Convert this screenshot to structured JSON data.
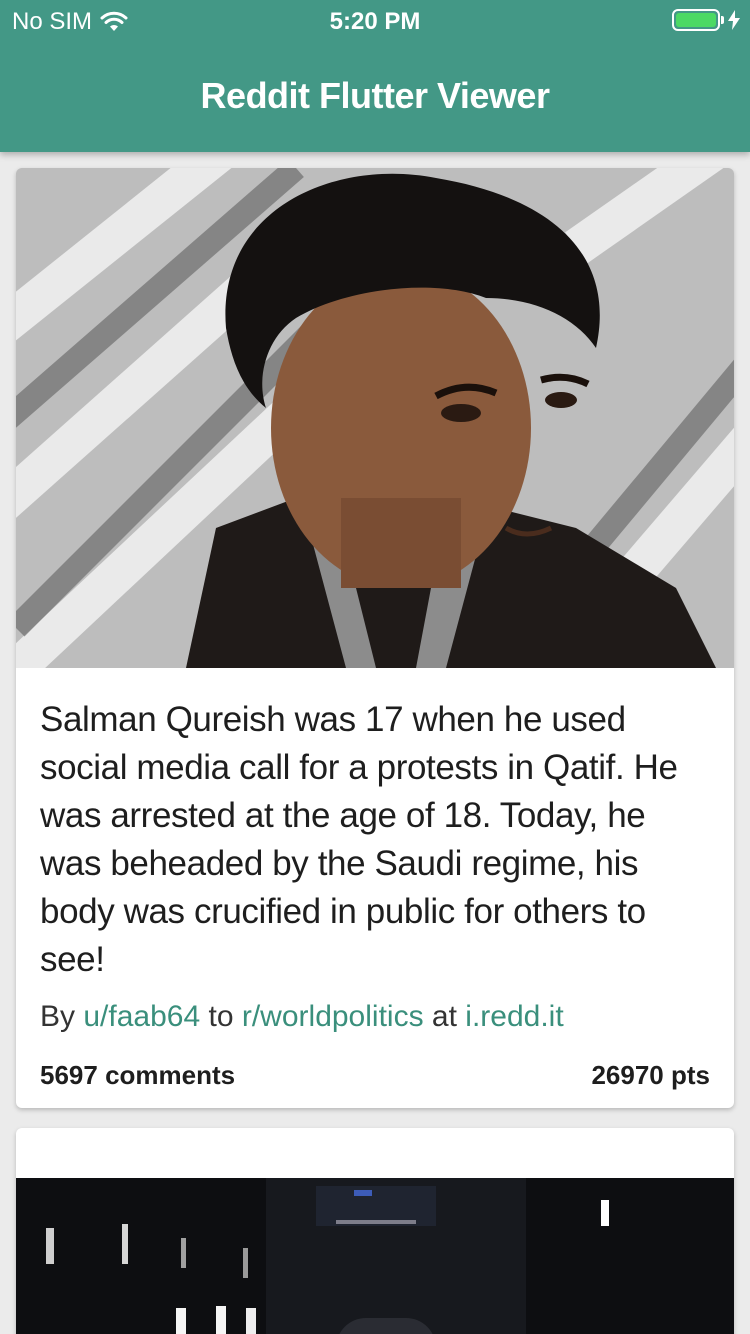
{
  "status_bar": {
    "carrier": "No SIM",
    "time": "5:20 PM"
  },
  "app_bar": {
    "title": "Reddit Flutter Viewer"
  },
  "posts": [
    {
      "title": "Salman Qureish was 17 when he used social media call for a protests in Qatif. He was arrested at the age of 18. Today, he was beheaded by the Saudi regime, his body was crucified in public for others to see!",
      "by_prefix": "By",
      "author": "u/faab64",
      "to_prefix": "to",
      "subreddit": "r/worldpolitics",
      "at_prefix": "at",
      "domain": "i.redd.it",
      "comments": "5697 comments",
      "points": "26970 pts"
    }
  ],
  "colors": {
    "primary": "#439886",
    "link": "#3a8f7c",
    "battery": "#4cd964"
  },
  "icons": [
    "wifi-icon",
    "battery-icon",
    "charging-bolt-icon"
  ]
}
